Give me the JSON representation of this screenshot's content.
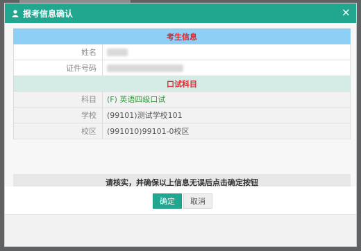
{
  "dialog": {
    "title": "报考信息确认",
    "close_label": "×",
    "colors": {
      "header": "#21a790",
      "section_header": "#8ecff5",
      "section_header_alt": "#d5ebe6",
      "highlight_red": "#e0262c",
      "subject_green": "#2f9b3b"
    }
  },
  "candidate_section": {
    "heading": "考生信息",
    "rows": [
      {
        "label": "姓名",
        "value": ""
      },
      {
        "label": "证件号码",
        "value": ""
      }
    ]
  },
  "exam_section": {
    "heading": "口试科目",
    "rows": [
      {
        "label": "科目",
        "value": "(F) 英语四级口试"
      },
      {
        "label": "学校",
        "value": "(99101)测试学校101"
      },
      {
        "label": "校区",
        "value": "(991010)99101-0校区"
      }
    ]
  },
  "notice": "请核实，并确保以上信息无误后点击确定按钮",
  "footer": {
    "ok_label": "确定",
    "cancel_label": "取消"
  }
}
